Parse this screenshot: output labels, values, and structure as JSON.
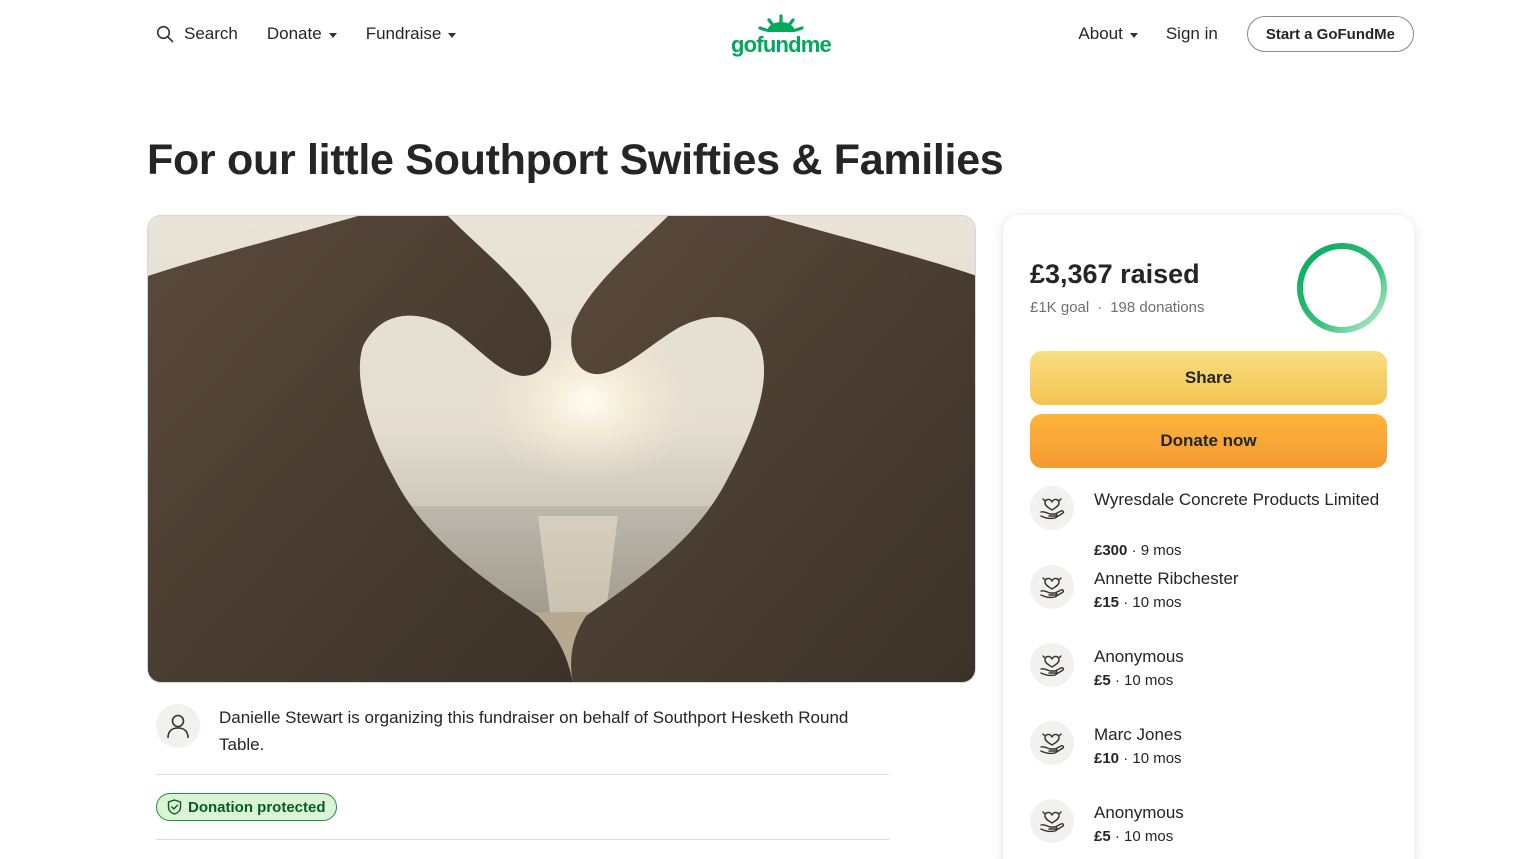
{
  "header": {
    "search_label": "Search",
    "donate_label": "Donate",
    "fundraise_label": "Fundraise",
    "logo_text": "gofundme",
    "about_label": "About",
    "signin_label": "Sign in",
    "start_label": "Start a GoFundMe"
  },
  "campaign": {
    "title": "For our little Southport Swifties & Families",
    "organizer_text": "Danielle Stewart is organizing this fundraiser on behalf of Southport Hesketh Round Table.",
    "protected_label": "Donation protected"
  },
  "card": {
    "raised": "£3,367 raised",
    "goal": "£1K goal",
    "separator": "·",
    "donations": "198 donations",
    "progress_fraction": 1.0,
    "share_label": "Share",
    "donate_label": "Donate now",
    "donors": [
      {
        "name": "Wyresdale Concrete Products Limited",
        "amount": "£300",
        "time": "· 9 mos"
      },
      {
        "name": "Annette Ribchester",
        "amount": "£15",
        "time": "· 10 mos"
      },
      {
        "name": "Anonymous",
        "amount": "£5",
        "time": "· 10 mos"
      },
      {
        "name": "Marc Jones",
        "amount": "£10",
        "time": "· 10 mos"
      },
      {
        "name": "Anonymous",
        "amount": "£5",
        "time": "· 10 mos"
      }
    ]
  },
  "colors": {
    "brand_green": "#02a95c",
    "share_yellow": "#f5c451",
    "donate_orange": "#f49a32"
  }
}
